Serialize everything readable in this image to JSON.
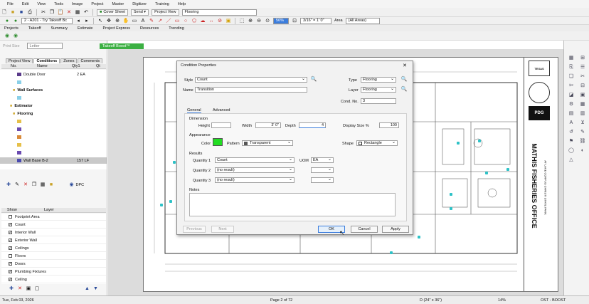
{
  "menu": [
    "File",
    "Edit",
    "View",
    "Tools",
    "Image",
    "Project",
    "Master",
    "Digitizer",
    "Training",
    "Help"
  ],
  "toolbar1": {
    "cover_sheet": "Cover Sheet",
    "send": "Send",
    "project_view": "Project View",
    "view_select": "Flooring"
  },
  "toolbar2": {
    "page_select": "2 - A201 - Try Takeoff Bc",
    "zoom": "56%",
    "scale": "3/16\" = 1' 0\"",
    "area_label": "Area",
    "area_select": "(All Areas)"
  },
  "nav_tabs": [
    "Projects",
    "Takeoff",
    "Summary",
    "Estimate",
    "Project Express",
    "Resources",
    "Trending"
  ],
  "left_panel": {
    "print_size_label": "Print Size",
    "print_size_value": "Letter",
    "tabs": [
      "Project View",
      "Conditions",
      "Zones",
      "Comments"
    ],
    "columns": [
      "No.",
      "Name",
      "Qty1",
      "Qt"
    ],
    "rows": [
      {
        "name": "Double Door",
        "qty": "2 EA",
        "color": "#5a3a8a"
      },
      {
        "name": "",
        "qty": "",
        "color": "#8ad0e8"
      },
      {
        "name": "Wall Surfaces",
        "qty": "",
        "color": ""
      },
      {
        "name": "",
        "qty": "",
        "color": "#8ad0e8"
      },
      {
        "name": "Estimator",
        "qty": "",
        "color": ""
      },
      {
        "name": "Flooring",
        "qty": "",
        "color": ""
      },
      {
        "name": "",
        "qty": "",
        "color": "#e6c04a"
      },
      {
        "name": "",
        "qty": "",
        "color": "#6a4ab0"
      },
      {
        "name": "",
        "qty": "",
        "color": "#d98a3a"
      },
      {
        "name": "",
        "qty": "",
        "color": "#e6c04a"
      },
      {
        "name": "",
        "qty": "",
        "color": "#6a4ab0"
      },
      {
        "name": "Wall Base B-2",
        "qty": "157 LF",
        "color": "#4a4ab0"
      }
    ],
    "dpc": "DPC",
    "layer_columns": [
      "Show",
      "Layer"
    ],
    "layers": [
      {
        "name": "Footprint Area",
        "checked": false
      },
      {
        "name": "Count",
        "checked": true
      },
      {
        "name": "Interior Wall",
        "checked": true
      },
      {
        "name": "Exterior Wall",
        "checked": true
      },
      {
        "name": "Ceilings",
        "checked": true
      },
      {
        "name": "Floors",
        "checked": false
      },
      {
        "name": "Doors",
        "checked": true
      },
      {
        "name": "Plumbing Fixtures",
        "checked": true
      },
      {
        "name": "Ceiling",
        "checked": true
      }
    ]
  },
  "canvas_tabs": [
    "Takeoff Boost™"
  ],
  "dialog": {
    "title": "Condition Properties",
    "style_label": "Style",
    "style_value": "Count",
    "name_label": "Name",
    "name_value": "Transition",
    "type_label": "Type",
    "type_value": "Flooring",
    "layer_label": "Layer",
    "layer_value": "Flooring",
    "cond_no_label": "Cond. No.",
    "cond_no_value": "3",
    "tabs": [
      "General",
      "Advanced"
    ],
    "dimension_label": "Dimension",
    "height_label": "Height",
    "width_label": "Width",
    "width_value": "3' 0\"",
    "depth_label": "Depth",
    "depth_value": "4",
    "display_size_label": "Display Size %",
    "display_size_value": "100",
    "appearance_label": "Appearance",
    "color_label": "Color",
    "color_value": "#22dd22",
    "pattern_label": "Pattern",
    "pattern_value": "Transparent",
    "shape_label": "Shape",
    "shape_value": "Rectangle",
    "results_label": "Results",
    "q1_label": "Quantity 1",
    "q1_value": "Count",
    "uom_label": "UOM",
    "uom_value": "EA",
    "q2_label": "Quantity 2",
    "q2_value": "(no result)",
    "q3_label": "Quantity 3",
    "q3_value": "(no result)",
    "notes_label": "Notes",
    "previous": "Previous",
    "next": "Next",
    "ok": "OK",
    "cancel": "Cancel",
    "apply": "Apply"
  },
  "titleblock": {
    "logo1": "TEXAS",
    "logo2": "PDG",
    "project": "MATHIS FISHERIES OFFICE",
    "sub": "AT LAKE CORPUS CHRISTI STATE PARK"
  },
  "status": {
    "date": "Tue, Feb 03, 2026",
    "page": "Page 2 of 72",
    "size": "D (24\" x 36\")",
    "zoom": "14%",
    "mode": "OST - BOOST"
  }
}
